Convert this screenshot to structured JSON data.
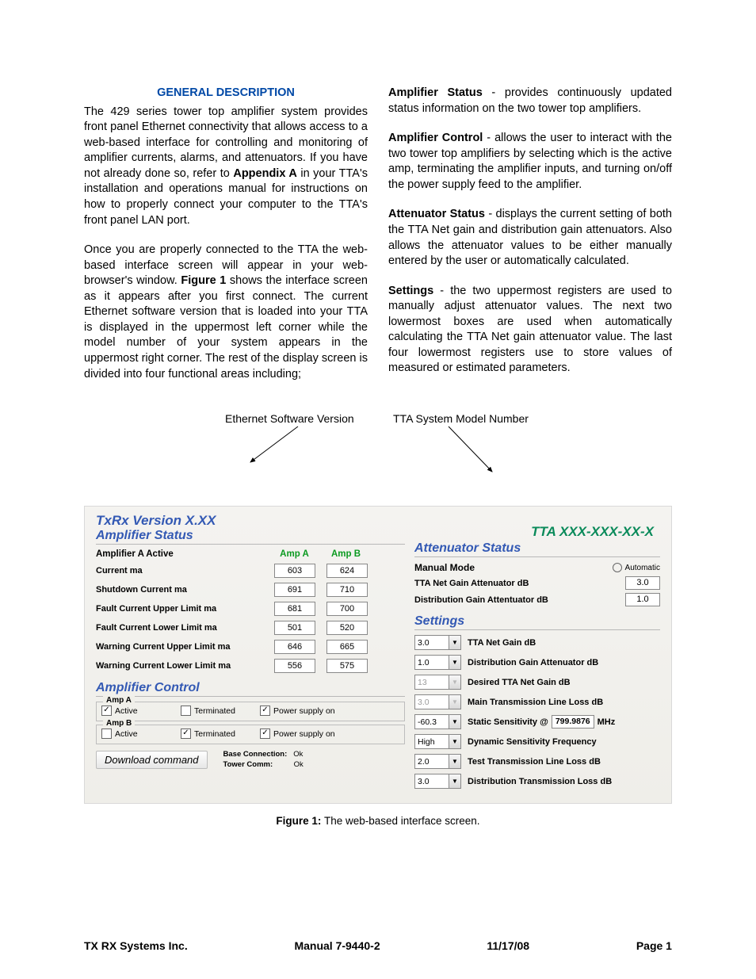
{
  "header": "GENERAL DESCRIPTION",
  "p1a": "The 429 series tower top amplifier system provides front panel Ethernet connectivity that allows access to a web-based interface for controlling and monitoring of amplifier currents, alarms, and attenuators. If you have not already done so, refer to ",
  "p1b": "Appendix A",
  "p1c": " in your TTA's installation and operations manual for instructions on how to properly connect your computer to the TTA's front panel LAN port.",
  "p2a": "Once you are properly connected to the TTA the web-based interface screen will appear in your web-browser's window. ",
  "p2b": "Figure 1",
  "p2c": " shows the interface screen as it appears after you first connect. The current Ethernet software version that is loaded into your TTA is displayed in the uppermost left corner while the model number of your system appears in the uppermost right corner. The rest of the display screen is divided into four functional areas including;",
  "r1a": "Amplifier Status",
  "r1b": " - provides continuously updated status information on the two tower top amplifiers.",
  "r2a": "Amplifier Control",
  "r2b": " - allows the user to interact with the two tower top amplifiers by selecting which is the active amp, terminating the amplifier inputs, and turning on/off the power supply feed to the amplifier.",
  "r3a": "Attenuator Status",
  "r3b": " - displays the current setting of both the TTA Net gain and distribution gain attenuators. Also allows the attenuator values to be either manually entered by the user or automatically calculated.",
  "r4a": "Settings",
  "r4b": " - the two uppermost registers are used to manually adjust attenuator values. The next two lowermost boxes are used when automatically calculating the TTA Net gain attenuator value. The last four lowermost registers use to store values of measured or estimated parameters.",
  "call1": "Ethernet Software Version",
  "call2": "TTA System Model Number",
  "ui": {
    "version": "TxRx Version X.XX",
    "model": "TTA XXX-XXX-XX-X",
    "amp_status": "Amplifier Status",
    "amp_active": "Amplifier A Active",
    "ampA": "Amp A",
    "ampB": "Amp  B",
    "rows": [
      {
        "l": "Current ma",
        "a": "603",
        "b": "624"
      },
      {
        "l": "Shutdown Current ma",
        "a": "691",
        "b": "710"
      },
      {
        "l": "Fault Current Upper Limit ma",
        "a": "681",
        "b": "700"
      },
      {
        "l": "Fault Current Lower Limit ma",
        "a": "501",
        "b": "520"
      },
      {
        "l": "Warning Current Upper Limit ma",
        "a": "646",
        "b": "665"
      },
      {
        "l": "Warning Current Lower Limit ma",
        "a": "556",
        "b": "575"
      }
    ],
    "amp_ctrl": "Amplifier Control",
    "ampA_l": "Amp A",
    "ampB_l": "Amp B",
    "ck_active": "Active",
    "ck_term": "Terminated",
    "ck_ps": "Power supply on",
    "dl": "Download command",
    "bc": "Base Connection:",
    "bc_v": "Ok",
    "tc": "Tower Comm:",
    "tc_v": "Ok",
    "att_status": "Attenuator Status",
    "manual": "Manual Mode",
    "auto": "Automatic",
    "att1": "TTA Net Gain Attenuator dB",
    "att1v": "3.0",
    "att2": "Distribution Gain Attentuator dB",
    "att2v": "1.0",
    "settings": "Settings",
    "s": [
      {
        "v": "3.0",
        "l": "TTA Net Gain dB",
        "en": true
      },
      {
        "v": "1.0",
        "l": "Distribution Gain Attenuator dB",
        "en": true
      },
      {
        "v": "13",
        "l": "Desired TTA Net Gain dB",
        "en": false
      },
      {
        "v": "3.0",
        "l": "Main Transmission Line Loss dB",
        "en": false
      },
      {
        "v": "-60.3",
        "l": "Static Sensitivity @",
        "en": true,
        "freq": "799.9876",
        "unit": "MHz"
      },
      {
        "v": "High",
        "l": "Dynamic Sensitivity Frequency",
        "en": true
      },
      {
        "v": "2.0",
        "l": "Test Transmission Line Loss dB",
        "en": true
      },
      {
        "v": "3.0",
        "l": "Distribution Transmission Loss dB",
        "en": true
      }
    ]
  },
  "caption_b": "Figure 1:",
  "caption": " The web-based interface screen.",
  "f1": "TX RX Systems Inc.",
  "f2": "Manual 7-9440-2",
  "f3": "11/17/08",
  "f4": "Page 1"
}
